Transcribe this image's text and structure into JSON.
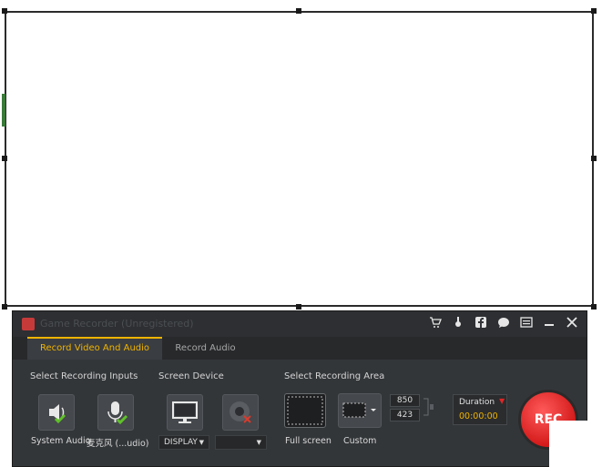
{
  "recorder": {
    "title": "Game Recorder (Unregistered)",
    "titlebar_icons": [
      "cart-icon",
      "pin-icon",
      "facebook-icon",
      "chat-icon",
      "menu-icon",
      "minimize-icon",
      "close-icon"
    ],
    "tabs": [
      {
        "label": "Record Video And Audio",
        "active": true
      },
      {
        "label": "Record Audio",
        "active": false
      }
    ],
    "sections": {
      "inputs": "Select Recording Inputs",
      "screen": "Screen Device",
      "area": "Select Recording Area"
    },
    "inputs": {
      "system_audio": "System Audio",
      "microphone": "麦克风 (...udio)"
    },
    "screen": {
      "display_value": "DISPLAY",
      "second_value": ""
    },
    "area": {
      "full_screen": "Full screen",
      "custom": "Custom",
      "width": "850",
      "height": "423"
    },
    "duration": {
      "label": "Duration",
      "value": "00:00:00"
    },
    "rec_label": "REC",
    "accent_color": "#f0b400",
    "check_color": "#5fc02a",
    "rec_color": "#e02626"
  }
}
